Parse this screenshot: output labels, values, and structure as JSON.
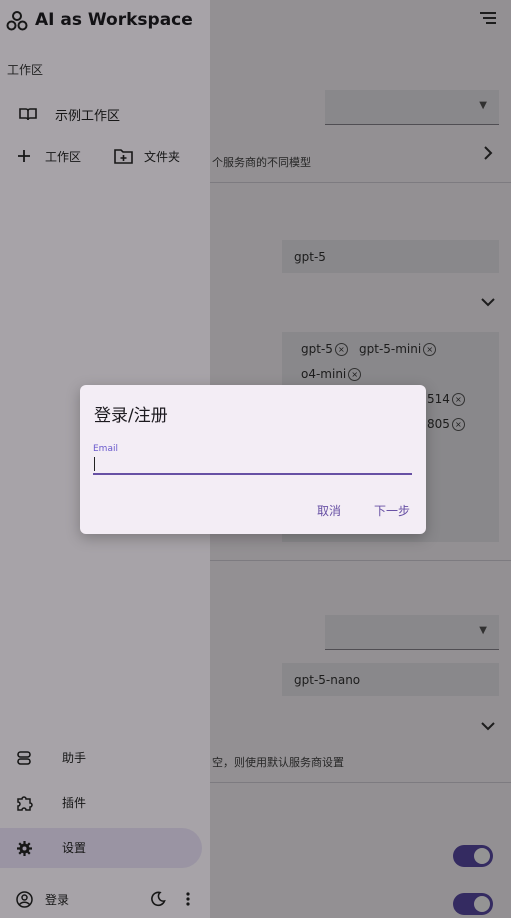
{
  "app": {
    "title": "AI as Workspace"
  },
  "drawer": {
    "section_label": "工作区",
    "workspace_item": "示例工作区",
    "add_workspace": "工作区",
    "add_folder": "文件夹",
    "bottom": {
      "assistant": "助手",
      "plugins": "插件",
      "settings": "设置",
      "login": "登录"
    }
  },
  "background": {
    "models_hint": "个服务商的不同模型",
    "default_model": "gpt-5",
    "chips": [
      "gpt-5",
      "gpt-5-mini",
      "o4-mini",
      "514",
      "805"
    ],
    "nano_model": "gpt-5-nano",
    "empty_hint": "空，则使用默认服务商设置"
  },
  "dialog": {
    "title": "登录/注册",
    "email_label": "Email",
    "email_value": "",
    "cancel": "取消",
    "next": "下一步"
  },
  "colors": {
    "accent": "#6750a4",
    "toggle_on": "#5b4aa8"
  }
}
